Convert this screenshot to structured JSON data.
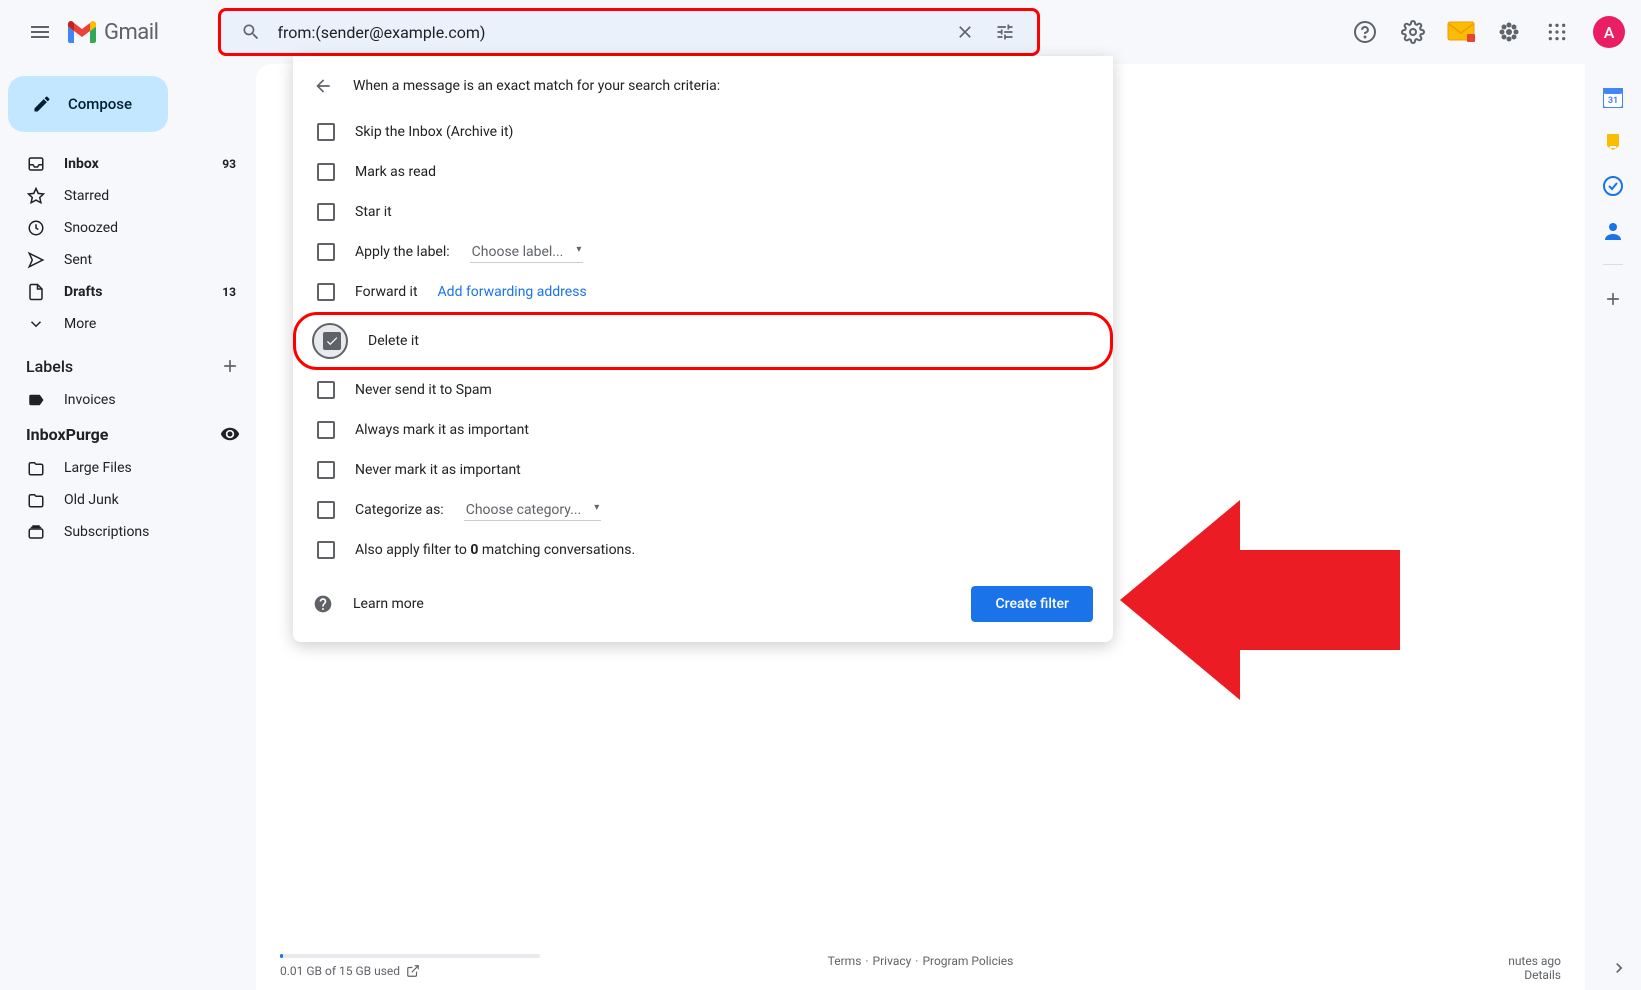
{
  "header": {
    "app_name": "Gmail",
    "search_value": "from:(sender@example.com)",
    "avatar_initial": "A"
  },
  "sidebar": {
    "compose_label": "Compose",
    "nav": [
      {
        "label": "Inbox",
        "count": "93",
        "bold": true
      },
      {
        "label": "Starred",
        "count": "",
        "bold": false
      },
      {
        "label": "Snoozed",
        "count": "",
        "bold": false
      },
      {
        "label": "Sent",
        "count": "",
        "bold": false
      },
      {
        "label": "Drafts",
        "count": "13",
        "bold": true
      },
      {
        "label": "More",
        "count": "",
        "bold": false
      }
    ],
    "labels_header": "Labels",
    "labels": [
      {
        "label": "Invoices"
      }
    ],
    "ext_header": "InboxPurge",
    "ext_items": [
      {
        "label": "Large Files"
      },
      {
        "label": "Old Junk"
      },
      {
        "label": "Subscriptions"
      }
    ]
  },
  "filter_panel": {
    "title": "When a message is an exact match for your search criteria:",
    "rows": [
      {
        "label": "Skip the Inbox (Archive it)",
        "checked": false
      },
      {
        "label": "Mark as read",
        "checked": false
      },
      {
        "label": "Star it",
        "checked": false
      },
      {
        "label": "Apply the label:",
        "select": "Choose label...",
        "checked": false
      },
      {
        "label": "Forward it",
        "link": "Add forwarding address",
        "checked": false
      },
      {
        "label": "Delete it",
        "checked": true,
        "highlighted": true
      },
      {
        "label": "Never send it to Spam",
        "checked": false
      },
      {
        "label": "Always mark it as important",
        "checked": false
      },
      {
        "label": "Never mark it as important",
        "checked": false
      },
      {
        "label": "Categorize as:",
        "select": "Choose category...",
        "checked": false
      }
    ],
    "apply_prefix": "Also apply filter to ",
    "apply_count": "0",
    "apply_suffix": " matching conversations.",
    "learn_more": "Learn more",
    "create_button": "Create filter"
  },
  "footer": {
    "storage": "0.01 GB of 15 GB used",
    "terms": "Terms",
    "privacy": "Privacy",
    "policies": "Program Policies",
    "activity_suffix": "nutes ago",
    "details": "Details"
  }
}
